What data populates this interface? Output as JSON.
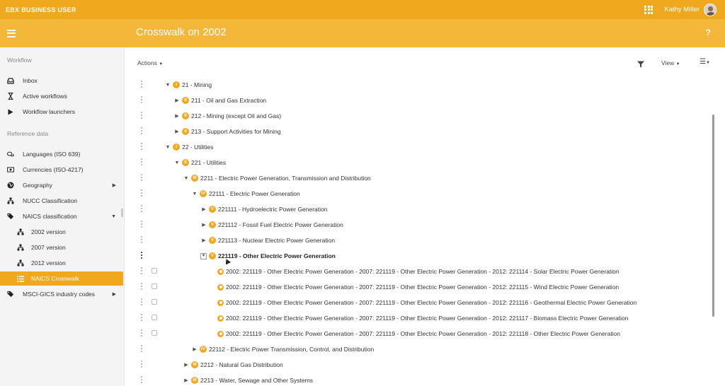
{
  "header": {
    "brand_bold": "EBX",
    "brand_rest": "BUSINESS USER",
    "user_name": "Kathy Miller"
  },
  "subheader": {
    "title": "Crosswalk on 2002",
    "help": "?"
  },
  "sidebar": {
    "workflow_title": "Workflow",
    "workflow_items": [
      {
        "label": "Inbox",
        "icon": "inbox-icon"
      },
      {
        "label": "Active workflows",
        "icon": "hourglass-icon"
      },
      {
        "label": "Workflow launchers",
        "icon": "play-icon"
      }
    ],
    "reference_title": "Reference data",
    "reference_items": [
      {
        "label": "Languages (ISO 639)",
        "icon": "speech-bubbles-icon"
      },
      {
        "label": "Currencies (ISO-4217)",
        "icon": "banknote-icon"
      },
      {
        "label": "Geography",
        "icon": "globe-icon"
      },
      {
        "label": "NUCC Classification",
        "icon": "hierarchy-icon"
      },
      {
        "label": "NAICS classification",
        "icon": "tags-icon"
      },
      {
        "label": "2002 version",
        "icon": "hierarchy-icon"
      },
      {
        "label": "2007 version",
        "icon": "hierarchy-icon"
      },
      {
        "label": "2012 version",
        "icon": "hierarchy-icon"
      },
      {
        "label": "NAICS Crosswalk",
        "icon": "list-icon"
      },
      {
        "label": "MSCI-GICS industry codes",
        "icon": "tags-icon"
      }
    ]
  },
  "toolbar": {
    "actions": "Actions",
    "view": "View"
  },
  "tree": {
    "rows": [
      {
        "badge": "I",
        "label": "21 - Mining"
      },
      {
        "badge": "II",
        "label": "211 - Oil and Gas Extraction"
      },
      {
        "badge": "II",
        "label": "212 - Mining (except Oil and Gas)"
      },
      {
        "badge": "II",
        "label": "213 - Support Activities for Mining"
      },
      {
        "badge": "I",
        "label": "22 - Utilities"
      },
      {
        "badge": "II",
        "label": "221 - Utilities"
      },
      {
        "badge": "III",
        "label": "2211 - Electric Power Generation, Transmission and Distribution"
      },
      {
        "badge": "IV",
        "label": "22111 - Electric Power Generation"
      },
      {
        "badge": "V",
        "label": "221111 - Hydroelectric Power Generation"
      },
      {
        "badge": "V",
        "label": "221112 - Fossil Fuel Electric Power Generation"
      },
      {
        "badge": "V",
        "label": "221113 - Nuclear Electric Power Generation"
      },
      {
        "badge": "V",
        "label": "221119 - Other Electric Power Generation"
      },
      {
        "badge": "",
        "label": "2002: 221119 - Other Electric Power Generation - 2007: 221119 - Other Electric Power Generation - 2012: 221114 - Solar Electric Power Generation"
      },
      {
        "badge": "",
        "label": "2002: 221119 - Other Electric Power Generation - 2007: 221119 - Other Electric Power Generation - 2012: 221115 - Wind Electric Power Generation"
      },
      {
        "badge": "",
        "label": "2002: 221119 - Other Electric Power Generation - 2007: 221119 - Other Electric Power Generation - 2012: 221116 - Geothermal Electric Power Generation"
      },
      {
        "badge": "",
        "label": "2002: 221119 - Other Electric Power Generation - 2007: 221119 - Other Electric Power Generation - 2012: 221117 - Biomass Electric Power Generation"
      },
      {
        "badge": "",
        "label": "2002: 221119 - Other Electric Power Generation - 2007: 221119 - Other Electric Power Generation - 2012: 221118 - Other Electric Power Generation"
      },
      {
        "badge": "IV",
        "label": "22112 - Electric Power Transmission, Control, and Distribution"
      },
      {
        "badge": "III",
        "label": "2212 - Natural Gas Distribution"
      },
      {
        "badge": "III",
        "label": "2213 - Water, Sewage and Other Systems"
      }
    ]
  },
  "colors": {
    "accent": "#f0a81e",
    "subheader": "#f4b73a",
    "sidebar_bg": "#f4f4f4"
  }
}
